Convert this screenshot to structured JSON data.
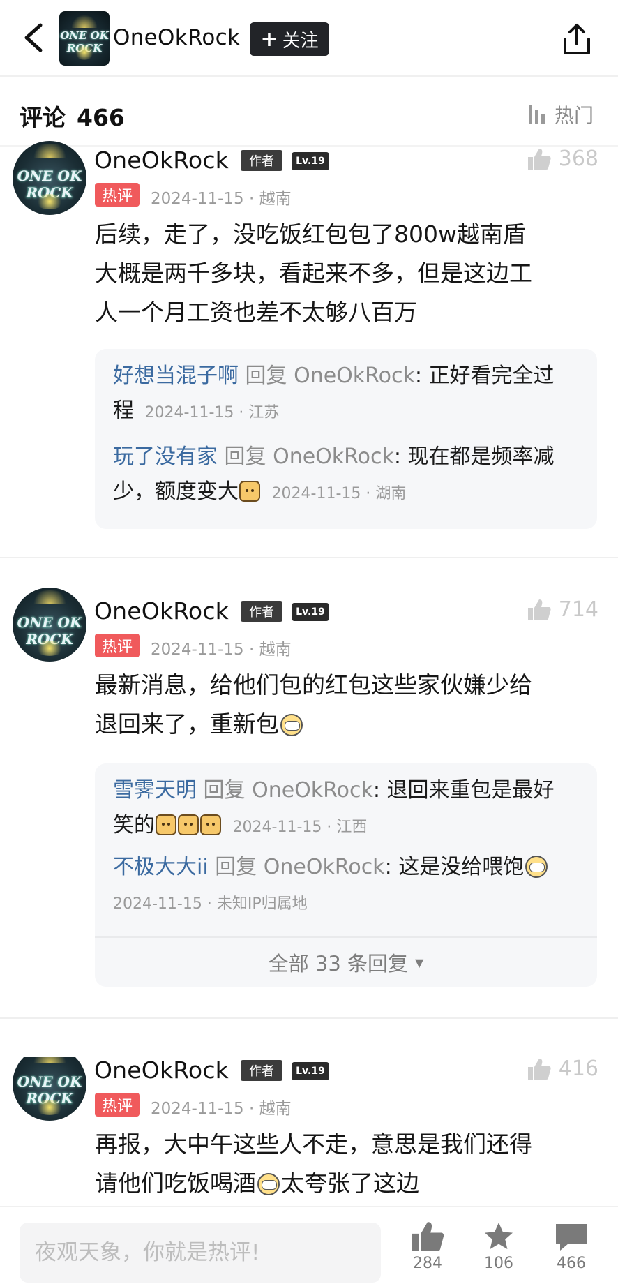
{
  "header": {
    "username": "OneOkRock",
    "avatar_text": "ONE OK ROCK",
    "follow_label": "关注"
  },
  "comments_header": {
    "label": "评论",
    "count": "466",
    "sort_label": "热门"
  },
  "comments": [
    {
      "username": "OneOkRock",
      "author_badge": "作者",
      "level": "Lv.19",
      "hot_badge": "热评",
      "meta": "2024-11-15 · 越南",
      "likes": "368",
      "lines": [
        "后续，走了，没吃饭红包包了800w越南盾",
        "大概是两千多块，看起来不多，但是这边工",
        "人一个月工资也差不太够八百万"
      ],
      "replies": [
        {
          "name": "好想当混子啊",
          "word": "回复",
          "target": "OneOkRock",
          "text1": ": 正好看完全过",
          "text2": "程",
          "meta": "2024-11-15 · 江苏"
        },
        {
          "name": "玩了没有家",
          "word": "回复",
          "target": "OneOkRock",
          "text1": ": 现在都是频率减",
          "text2": "少，额度变大",
          "meta": "2024-11-15 · 湖南"
        }
      ]
    },
    {
      "username": "OneOkRock",
      "author_badge": "作者",
      "level": "Lv.19",
      "hot_badge": "热评",
      "meta": "2024-11-15 · 越南",
      "likes": "714",
      "lines": [
        "最新消息，给他们包的红包这些家伙嫌少给",
        "退回来了，重新包"
      ],
      "replies": [
        {
          "name": "雪霁天明",
          "word": "回复",
          "target": "OneOkRock",
          "text1": ": 退回来重包是最好",
          "text2": "笑的",
          "meta": "2024-11-15 · 江西"
        },
        {
          "name": "不极大大ii",
          "word": "回复",
          "target": "OneOkRock",
          "text1": ": 这是没给喂饱",
          "text2": "",
          "meta": "2024-11-15 · 未知IP归属地"
        }
      ],
      "all_replies": "全部 33 条回复"
    },
    {
      "username": "OneOkRock",
      "author_badge": "作者",
      "level": "Lv.19",
      "hot_badge": "热评",
      "meta": "2024-11-15 · 越南",
      "likes": "416",
      "lines": [
        "再报，大中午这些人不走，意思是我们还得",
        "请他们吃饭喝酒",
        "太夸张了这边"
      ]
    }
  ],
  "bottom_bar": {
    "placeholder": "夜观天象，你就是热评!",
    "likes": "284",
    "favorites": "106",
    "comments": "466"
  },
  "colors": {
    "hot_badge": "#f05a5c",
    "reply_name": "#3b6aa0",
    "follow_bg": "#222428"
  }
}
